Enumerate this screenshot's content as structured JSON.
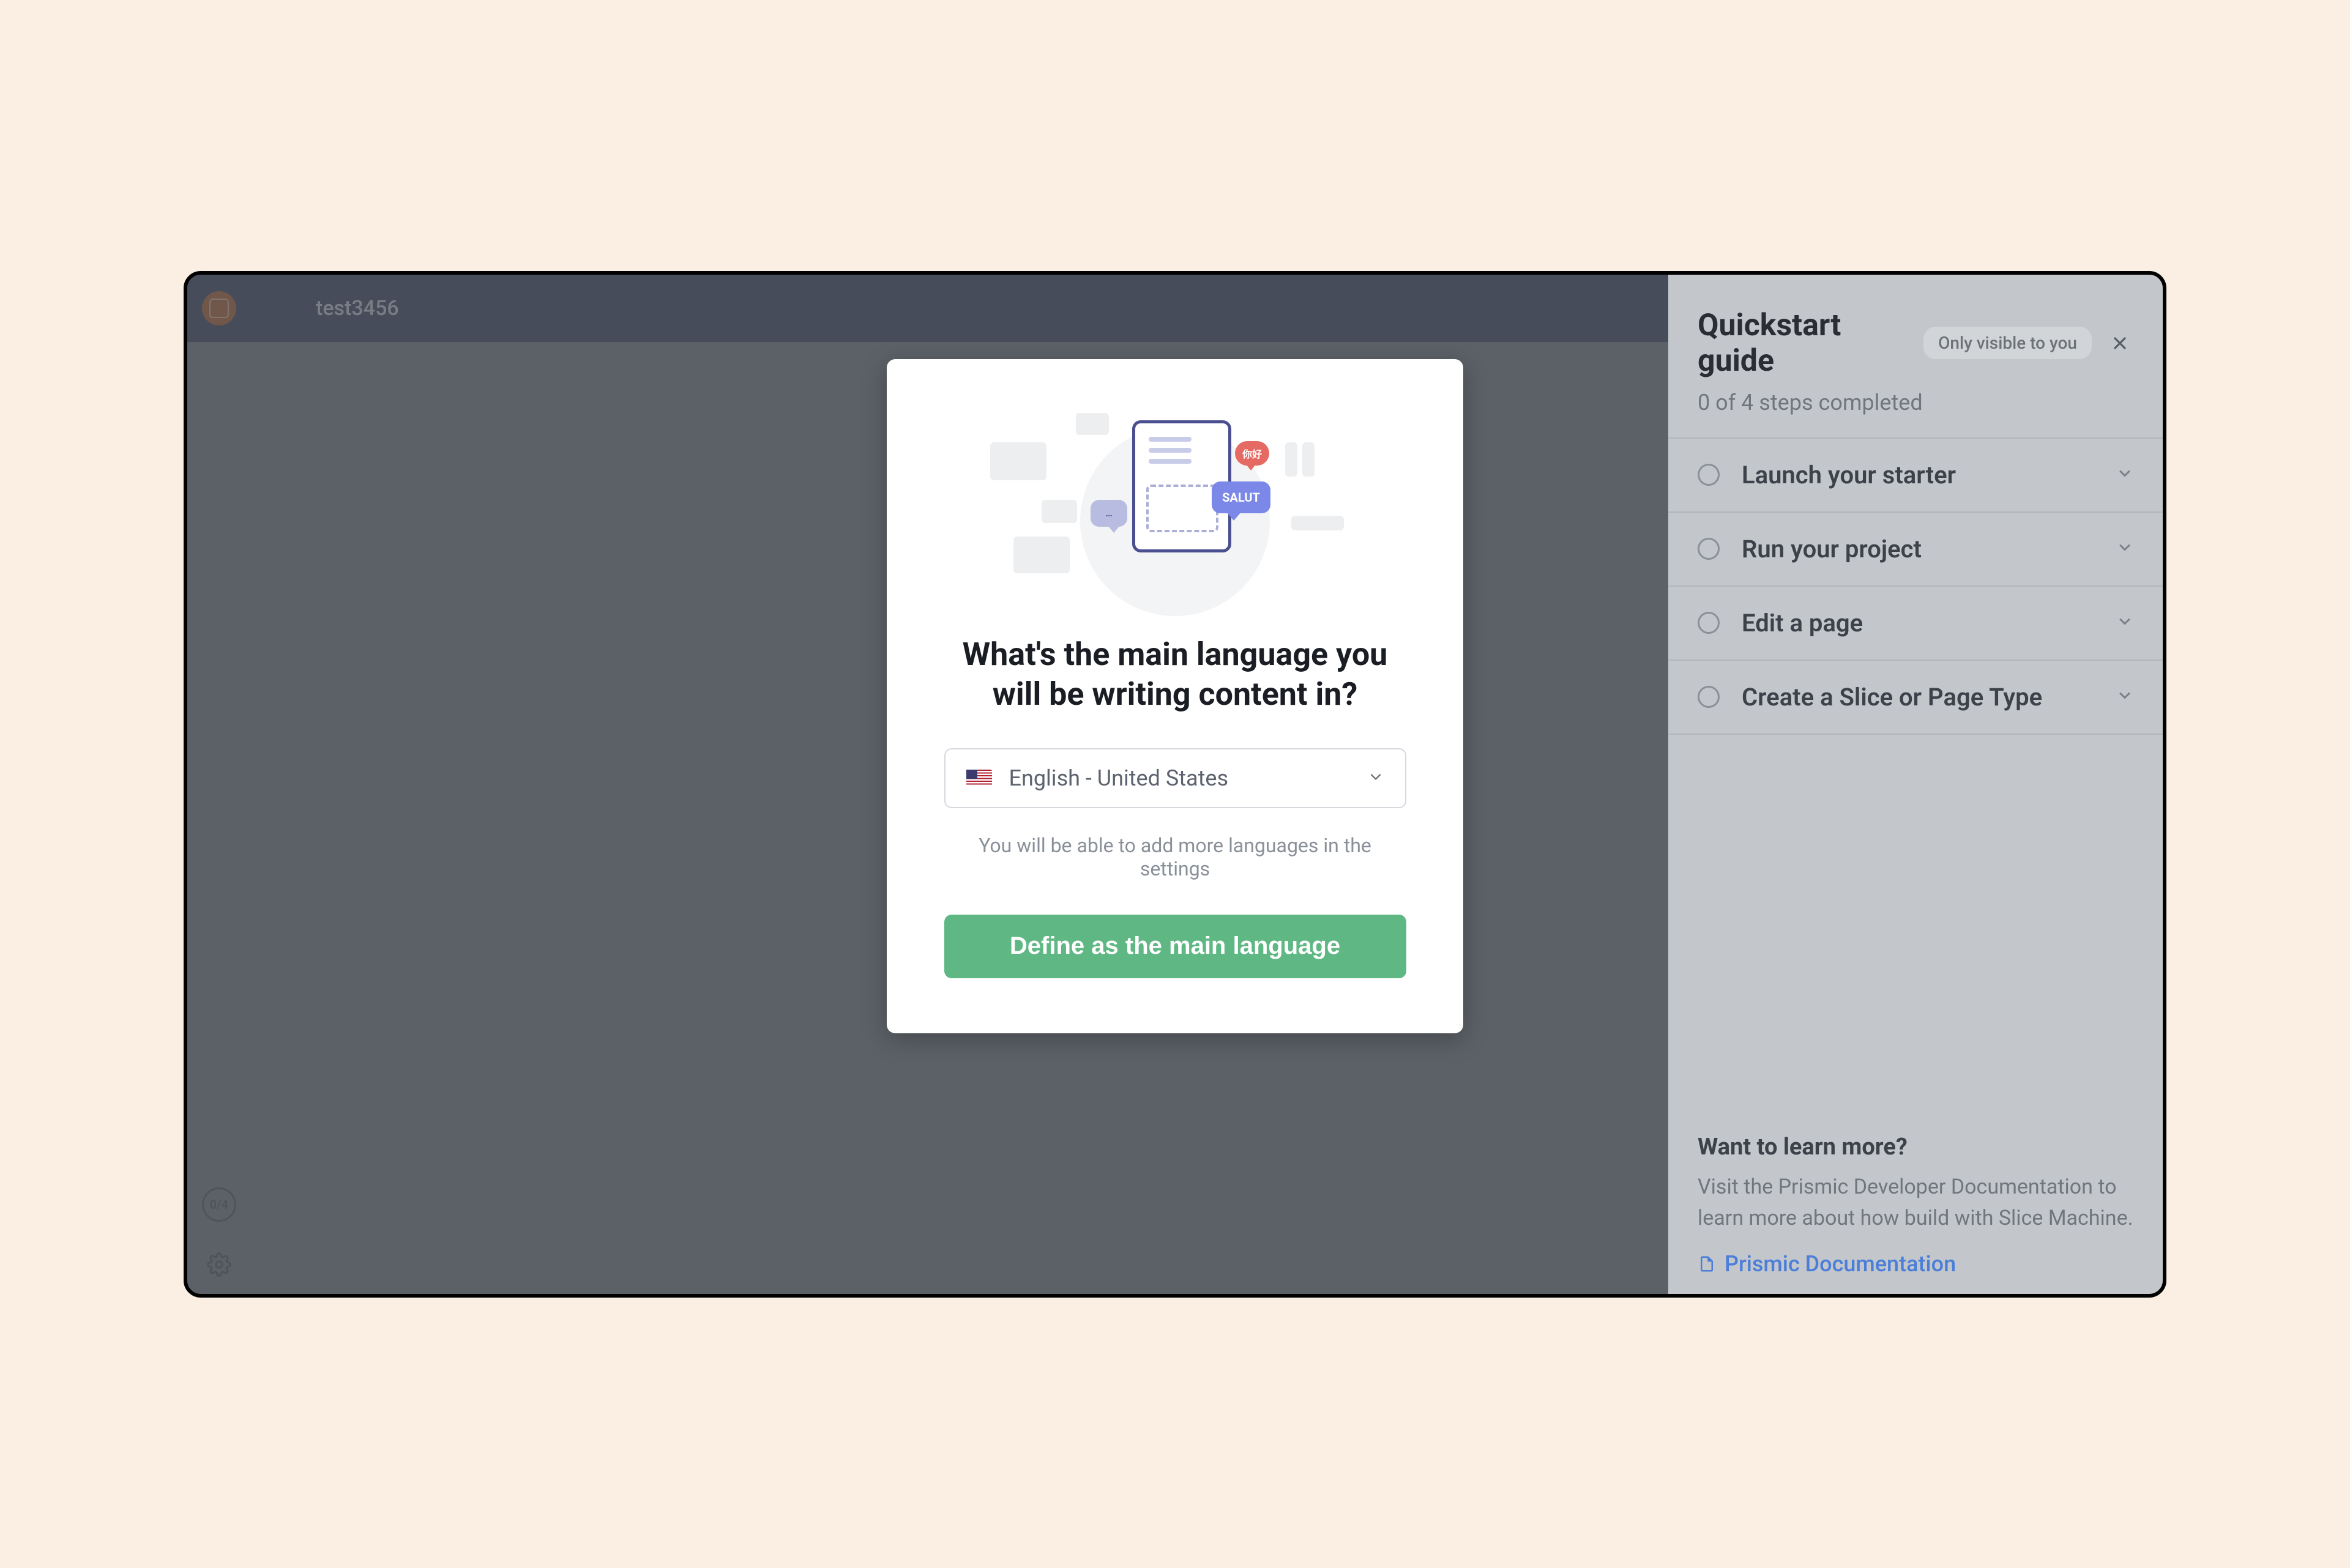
{
  "header": {
    "project_name": "test3456"
  },
  "sidebar": {
    "progress_badge": "0/4"
  },
  "modal": {
    "title": "What's the main language you will be writing content in?",
    "language_selected": "English - United States",
    "hint": "You will be able to add more languages in the settings",
    "cta": "Define as the main language",
    "bubble_salut": "SALUT",
    "bubble_noti": "你好"
  },
  "quickstart": {
    "title": "Quickstart guide",
    "visibility": "Only visible to you",
    "subtitle": "0 of 4 steps completed",
    "steps": [
      {
        "label": "Launch your starter"
      },
      {
        "label": "Run your project"
      },
      {
        "label": "Edit a page"
      },
      {
        "label": "Create a Slice or Page Type"
      }
    ],
    "footer": {
      "title": "Want to learn more?",
      "text": "Visit the Prismic Developer Documentation to learn more about how build with Slice Machine.",
      "link": "Prismic Documentation"
    }
  }
}
